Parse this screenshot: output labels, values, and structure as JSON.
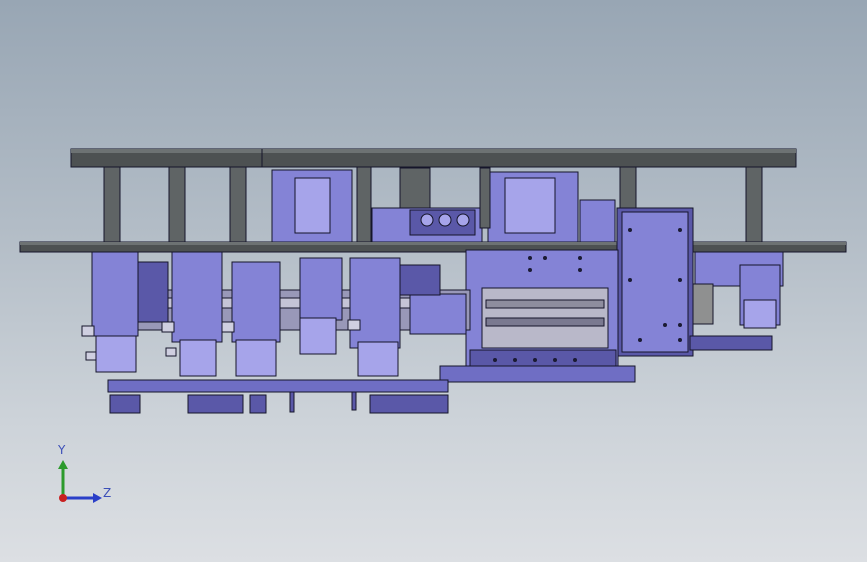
{
  "viewport": {
    "background_top": "#98a6b4",
    "background_bottom": "#dcdfe3"
  },
  "model": {
    "plate_color": "#4d5152",
    "plate_top_color": "#6d7273",
    "part_color": "#8483d6",
    "part_dark": "#5a58a8",
    "part_light": "#a6a4ea",
    "edge_color": "#15152a",
    "hole_color": "#1b1b33"
  },
  "triad": {
    "y_label": "Y",
    "z_label": "Z",
    "y_color": "#2c9a2c",
    "z_color": "#2a3fc8",
    "origin_color": "#c82020",
    "icon": "coordinate-triad-icon"
  }
}
